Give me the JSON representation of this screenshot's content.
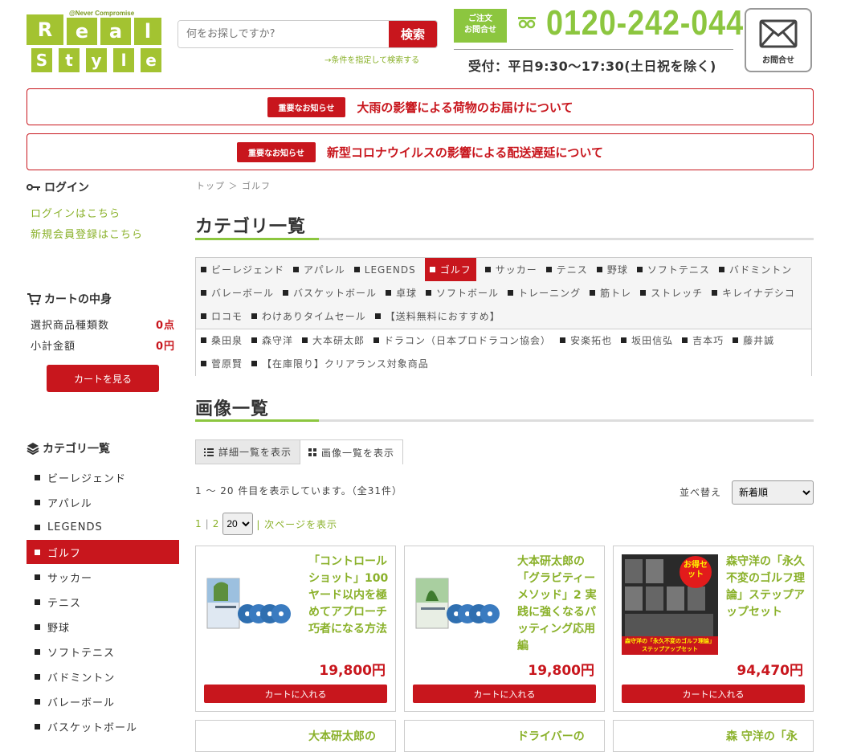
{
  "header": {
    "logo": {
      "tagline": "@Never Compromise",
      "letters_top": [
        "R",
        "e",
        "a",
        "l"
      ],
      "letters_bottom": [
        "S",
        "t",
        "y",
        "l",
        "e"
      ]
    },
    "search": {
      "placeholder": "何をお探しですか?",
      "button": "検索",
      "advanced_link": "→条件を指定して検索する"
    },
    "order_contact": "ご注文\nお問合せ",
    "phone": "0120-242-044",
    "hours": "受付：平日9:30〜17:30(土日祝を除く)",
    "contact_label": "お問合せ"
  },
  "notices": [
    {
      "badge": "重要なお知らせ",
      "text": "大雨の影響による荷物のお届けについて"
    },
    {
      "badge": "重要なお知らせ",
      "text": "新型コロナウイルスの影響による配送遅延について"
    }
  ],
  "sidebar": {
    "login": {
      "title": "ログイン",
      "links": [
        "ログインはこちら",
        "新規会員登録はこちら"
      ]
    },
    "cart": {
      "title": "カートの中身",
      "rows": [
        {
          "label": "選択商品種類数",
          "value": "0点"
        },
        {
          "label": "小計金額",
          "value": "0円"
        }
      ],
      "button": "カートを見る"
    },
    "categories": {
      "title": "カテゴリ一覧",
      "items": [
        "ビーレジェンド",
        "アパレル",
        "LEGENDS",
        "ゴルフ",
        "サッカー",
        "テニス",
        "野球",
        "ソフトテニス",
        "バドミントン",
        "バレーボール",
        "バスケットボール"
      ],
      "active": "ゴルフ"
    }
  },
  "main": {
    "breadcrumb": "トップ ＞ ゴルフ",
    "category_title": "カテゴリ一覧",
    "category_rows": [
      [
        "ビーレジェンド",
        "アパレル",
        "LEGENDS",
        "ゴルフ",
        "サッカー",
        "テニス",
        "野球",
        "ソフトテニス",
        "バドミントン"
      ],
      [
        "バレーボール",
        "バスケットボール",
        "卓球",
        "ソフトボール",
        "トレーニング",
        "筋トレ",
        "ストレッチ",
        "キレイナデシコ"
      ],
      [
        "ロコモ",
        "わけありタイムセール",
        "【送料無料におすすめ】"
      ],
      [
        "桑田泉",
        "森守洋",
        "大本研太郎",
        "ドラコン（日本プロドラコン協会）",
        "安楽拓也",
        "坂田信弘",
        "吉本巧",
        "藤井誠"
      ],
      [
        "菅原賢",
        "【在庫限り】クリアランス対象商品"
      ]
    ],
    "image_title": "画像一覧",
    "tabs": {
      "detail": "詳細一覧を表示",
      "image": "画像一覧を表示"
    },
    "count_text": "1 〜 20 件目を表示しています。（全31件）",
    "sort_label": "並べ替え",
    "sort_value": "新着順",
    "pager": {
      "page1": "1",
      "page2": "2",
      "per_page": "20",
      "next": "| 次ページを表示"
    },
    "products": [
      {
        "name": "「コントロールショット」100ヤード以内を極めてアプローチ巧者になる方法",
        "price": "19,800円",
        "button": "カートに入れる"
      },
      {
        "name": "大本研太郎の「グラビティーメソッド」2 実践に強くなるパッティング応用編",
        "price": "19,800円",
        "button": "カートに入れる"
      },
      {
        "name": "森守洋の「永久不変のゴルフ理論」ステップアップセット",
        "price": "94,470円",
        "button": "カートに入れる",
        "thumb_badge": "お得セット",
        "thumb_caption": "森守洋の「永久不変のゴルフ理論」ステップアップセット"
      }
    ],
    "products_next": [
      "大本研太郎の",
      "ドライバーの",
      "森 守洋の「永"
    ]
  },
  "colors": {
    "brand_green": "#8cc63f",
    "accent_red": "#c8161d"
  }
}
